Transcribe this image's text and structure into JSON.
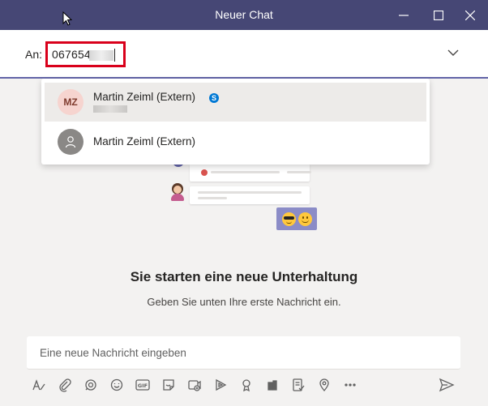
{
  "window": {
    "title": "Neuer Chat"
  },
  "to_field": {
    "label": "An:",
    "value": "067654"
  },
  "suggestions": [
    {
      "initials": "MZ",
      "name": "Martin Zeiml (Extern)",
      "badge": "S"
    },
    {
      "initials": "",
      "name": "Martin Zeiml (Extern)"
    }
  ],
  "empty_state": {
    "title": "Sie starten eine neue Unterhaltung",
    "subtitle": "Geben Sie unten Ihre erste Nachricht ein."
  },
  "compose": {
    "placeholder": "Eine neue Nachricht eingeben"
  },
  "toolbar_icons": [
    "format-icon",
    "attach-icon",
    "loop-icon",
    "emoji-icon",
    "gif-icon",
    "sticker-icon",
    "meet-now-icon",
    "stream-icon",
    "praise-icon",
    "apps-icon",
    "approvals-icon",
    "location-icon",
    "more-icon"
  ],
  "colors": {
    "titlebar": "#464775",
    "accent": "#6264a7",
    "highlight_border": "#d9001b"
  }
}
